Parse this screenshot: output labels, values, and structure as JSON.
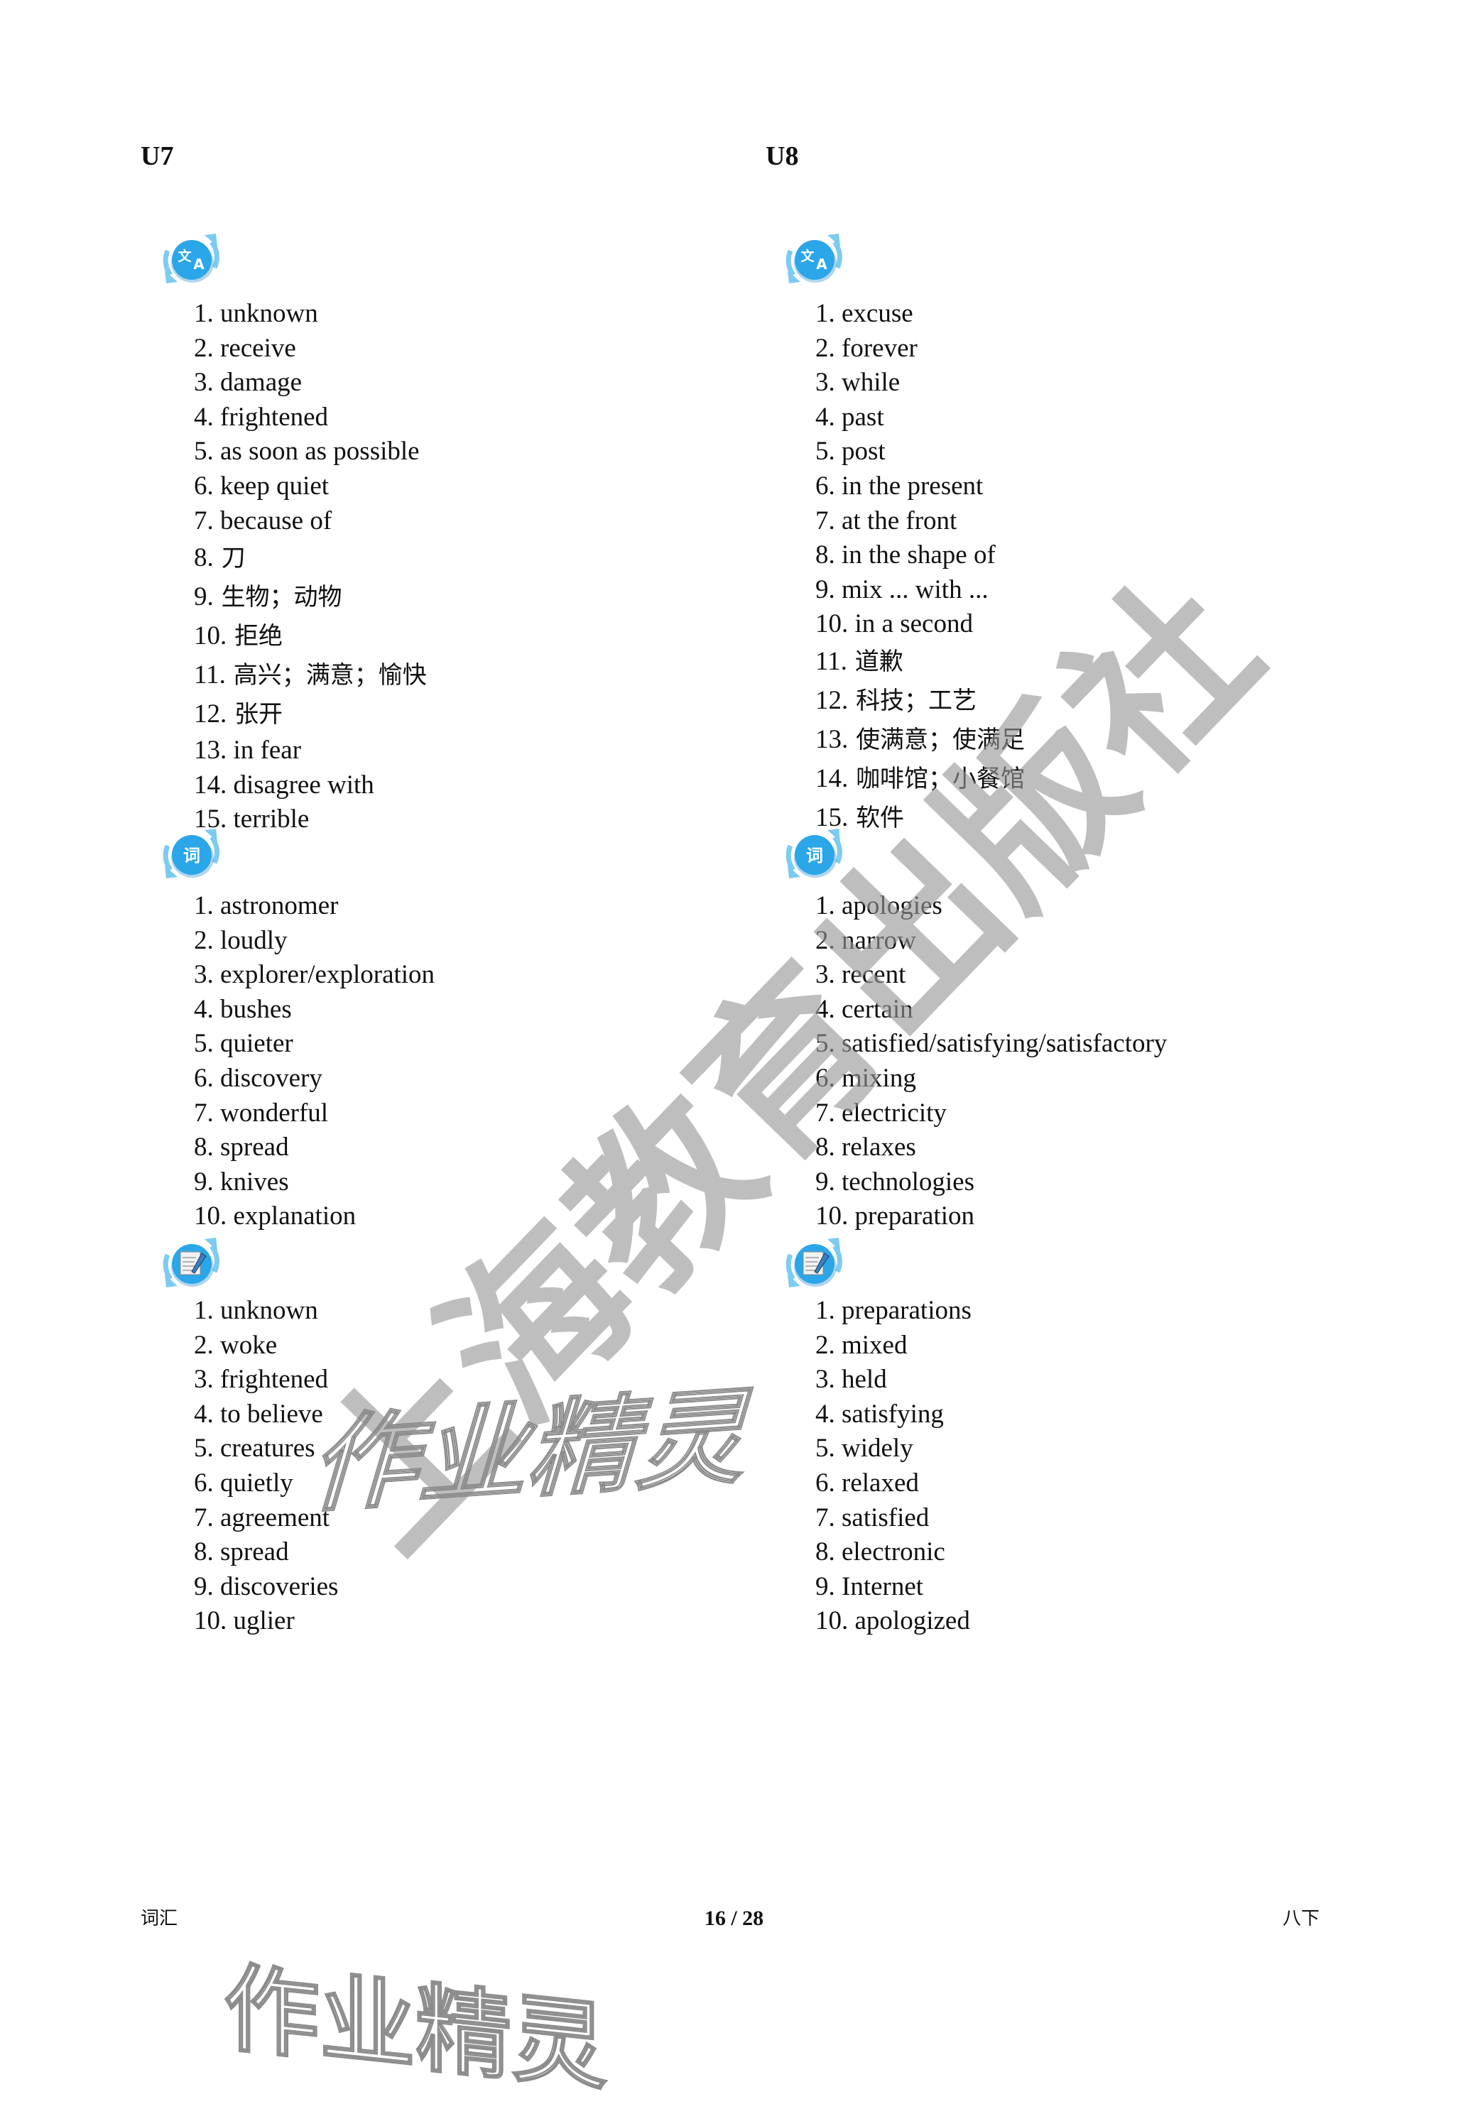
{
  "units": [
    {
      "heading": "U7",
      "sections": [
        {
          "icon": "translate-icon",
          "items": [
            {
              "num": "1.",
              "text": "unknown"
            },
            {
              "num": "2.",
              "text": "receive"
            },
            {
              "num": "3.",
              "text": "damage"
            },
            {
              "num": "4.",
              "text": "frightened"
            },
            {
              "num": "5.",
              "text": "as soon as possible"
            },
            {
              "num": "6.",
              "text": "keep quiet"
            },
            {
              "num": "7.",
              "text": "because of"
            },
            {
              "num": "8.",
              "text": "刀",
              "cjk": true
            },
            {
              "num": "9.",
              "text": "生物；动物",
              "cjk": true
            },
            {
              "num": "10.",
              "text": "拒绝",
              "cjk": true
            },
            {
              "num": "11.",
              "text": "高兴；满意；愉快",
              "cjk": true
            },
            {
              "num": "12.",
              "text": "张开",
              "cjk": true
            },
            {
              "num": "13.",
              "text": "in fear"
            },
            {
              "num": "14.",
              "text": "disagree with"
            },
            {
              "num": "15.",
              "text": "terrible"
            }
          ]
        },
        {
          "icon": "word-ci-icon",
          "icon_glyph": "词",
          "items": [
            {
              "num": "1.",
              "text": "astronomer"
            },
            {
              "num": "2.",
              "text": "loudly"
            },
            {
              "num": "3.",
              "text": "explorer/exploration"
            },
            {
              "num": "4.",
              "text": "bushes"
            },
            {
              "num": "5.",
              "text": "quieter"
            },
            {
              "num": "6.",
              "text": "discovery"
            },
            {
              "num": "7.",
              "text": "wonderful"
            },
            {
              "num": "8.",
              "text": "spread"
            },
            {
              "num": "9.",
              "text": "knives"
            },
            {
              "num": "10.",
              "text": "explanation"
            }
          ]
        },
        {
          "icon": "notepad-pen-icon",
          "items": [
            {
              "num": "1.",
              "text": "unknown"
            },
            {
              "num": "2.",
              "text": "woke"
            },
            {
              "num": "3.",
              "text": "frightened"
            },
            {
              "num": "4.",
              "text": "to believe"
            },
            {
              "num": "5.",
              "text": "creatures"
            },
            {
              "num": "6.",
              "text": "quietly"
            },
            {
              "num": "7.",
              "text": "agreement"
            },
            {
              "num": "8.",
              "text": "spread"
            },
            {
              "num": "9.",
              "text": "discoveries"
            },
            {
              "num": "10.",
              "text": "uglier"
            }
          ]
        }
      ]
    },
    {
      "heading": "U8",
      "sections": [
        {
          "icon": "translate-icon",
          "items": [
            {
              "num": "1.",
              "text": "excuse"
            },
            {
              "num": "2.",
              "text": "forever"
            },
            {
              "num": "3.",
              "text": "while"
            },
            {
              "num": "4.",
              "text": "past"
            },
            {
              "num": "5.",
              "text": "post"
            },
            {
              "num": "6.",
              "text": "in the present"
            },
            {
              "num": "7.",
              "text": "at the front"
            },
            {
              "num": "8.",
              "text": "in the shape of"
            },
            {
              "num": "9.",
              "text": "mix ... with ..."
            },
            {
              "num": "10.",
              "text": "in a second"
            },
            {
              "num": "11.",
              "text": "道歉",
              "cjk": true
            },
            {
              "num": "12.",
              "text": "科技；工艺",
              "cjk": true
            },
            {
              "num": "13.",
              "text": "使满意；使满足",
              "cjk": true
            },
            {
              "num": "14.",
              "text": "咖啡馆；小餐馆",
              "cjk": true
            },
            {
              "num": "15.",
              "text": "软件",
              "cjk": true
            }
          ]
        },
        {
          "icon": "word-ci-icon",
          "icon_glyph": "词",
          "items": [
            {
              "num": "1.",
              "text": "apologies"
            },
            {
              "num": "2.",
              "text": "narrow"
            },
            {
              "num": "3.",
              "text": "recent"
            },
            {
              "num": "4.",
              "text": "certain"
            },
            {
              "num": "5.",
              "text": "satisfied/satisfying/satisfactory"
            },
            {
              "num": "6.",
              "text": "mixing"
            },
            {
              "num": "7.",
              "text": "electricity"
            },
            {
              "num": "8.",
              "text": "relaxes"
            },
            {
              "num": "9.",
              "text": "technologies"
            },
            {
              "num": "10.",
              "text": "preparation"
            }
          ]
        },
        {
          "icon": "notepad-pen-icon",
          "items": [
            {
              "num": "1.",
              "text": "preparations"
            },
            {
              "num": "2.",
              "text": "mixed"
            },
            {
              "num": "3.",
              "text": "held"
            },
            {
              "num": "4.",
              "text": "satisfying"
            },
            {
              "num": "5.",
              "text": "widely"
            },
            {
              "num": "6.",
              "text": "relaxed"
            },
            {
              "num": "7.",
              "text": "satisfied"
            },
            {
              "num": "8.",
              "text": "electronic"
            },
            {
              "num": "9.",
              "text": "Internet"
            },
            {
              "num": "10.",
              "text": "apologized"
            }
          ]
        }
      ]
    }
  ],
  "footer": {
    "left": "词汇",
    "page": "16 / 28",
    "right": "八下"
  },
  "watermarks": {
    "publisher": "上海教育出版社",
    "brand": "作业精灵"
  },
  "colors": {
    "icon_blue": "#2BA6E8",
    "icon_arrow": "#7CCBF0",
    "watermark_gray": "#999999"
  }
}
